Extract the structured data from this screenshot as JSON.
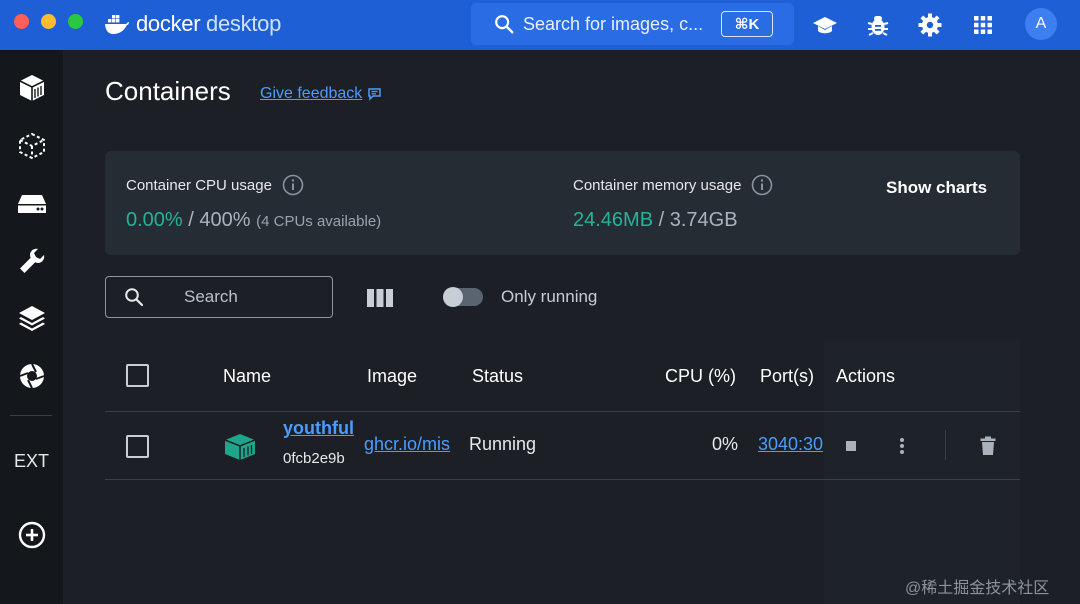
{
  "app": {
    "brand_primary": "docker",
    "brand_secondary": "desktop",
    "accent_color": "#1f5fd6"
  },
  "titlebar": {
    "search_placeholder": "Search for images, c...",
    "search_shortcut": "⌘K",
    "icons": [
      "learning-center-icon",
      "troubleshoot-bug-icon",
      "settings-gear-icon",
      "apps-grid-icon"
    ],
    "avatar_letter": "A"
  },
  "sidebar": {
    "items": [
      {
        "name": "containers",
        "icon": "container-cube-icon"
      },
      {
        "name": "images",
        "icon": "image-dotted-cube-icon"
      },
      {
        "name": "volumes",
        "icon": "volume-drive-icon"
      },
      {
        "name": "dev-environments",
        "icon": "wrench-icon"
      },
      {
        "name": "docker-scout",
        "icon": "layers-icon"
      },
      {
        "name": "extensions",
        "icon": "aperture-icon"
      }
    ],
    "ext_label": "EXT",
    "add_extension_icon": "plus-circle-icon"
  },
  "page": {
    "title": "Containers",
    "feedback_label": "Give feedback"
  },
  "stats": {
    "cpu_label": "Container CPU usage",
    "cpu_used": "0.00%",
    "cpu_total": "/ 400%",
    "cpu_note": "(4 CPUs available)",
    "mem_label": "Container memory usage",
    "mem_used": "24.46MB",
    "mem_total": "/ 3.74GB",
    "show_charts_label": "Show charts",
    "value_color": "#22b49a"
  },
  "toolbar": {
    "search_placeholder": "Search",
    "only_running_label": "Only running",
    "only_running_on": false
  },
  "table": {
    "headers": [
      "Name",
      "Image",
      "Status",
      "CPU (%)",
      "Port(s)",
      "Actions"
    ],
    "rows": [
      {
        "name": "youthful",
        "id": "0fcb2e9b",
        "image": "ghcr.io/mis",
        "status": "Running",
        "cpu": "0%",
        "ports": "3040:30"
      }
    ]
  },
  "watermark": "@稀土掘金技术社区"
}
